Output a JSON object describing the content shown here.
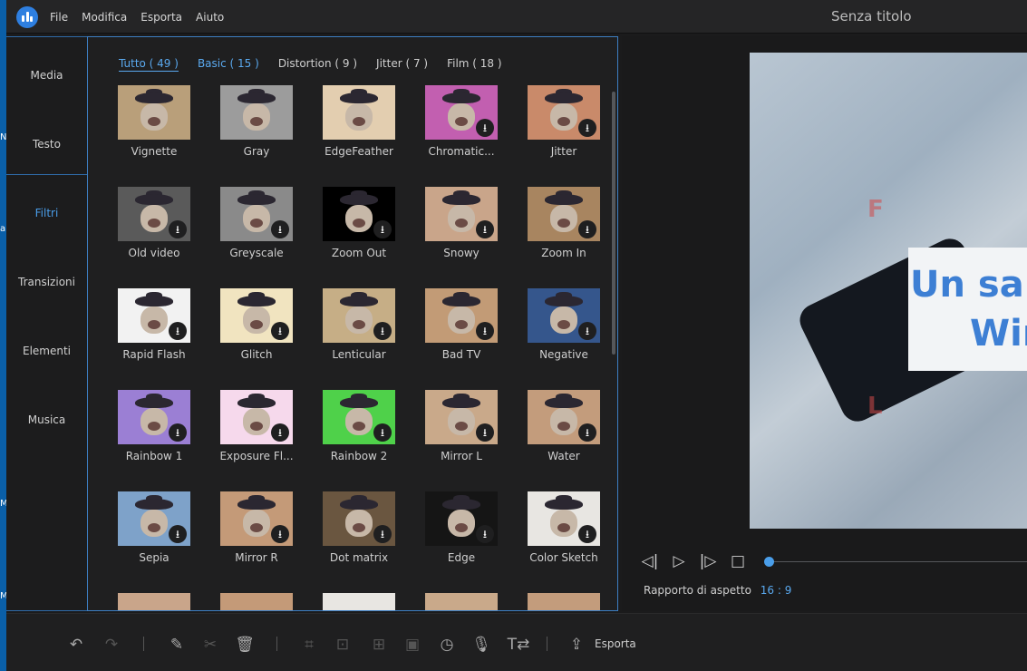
{
  "menu": {
    "file": "File",
    "edit": "Modifica",
    "export": "Esporta",
    "help": "Aiuto"
  },
  "window_title": "Senza titolo",
  "desktop_strip_labels": [
    "N",
    "a",
    "M",
    "M"
  ],
  "sidebar": {
    "items": [
      {
        "label": "Media",
        "active": false
      },
      {
        "label": "Testo",
        "active": false
      },
      {
        "label": "Filtri",
        "active": true
      },
      {
        "label": "Transizioni",
        "active": false
      },
      {
        "label": "Elementi",
        "active": false
      },
      {
        "label": "Musica",
        "active": false
      }
    ]
  },
  "filter_tabs": [
    {
      "label": "Tutto ( 49 )",
      "active": true
    },
    {
      "label": "Basic ( 15 )",
      "active": false
    },
    {
      "label": "Distortion ( 9 )",
      "active": false
    },
    {
      "label": "Jitter ( 7 )",
      "active": false
    },
    {
      "label": "Film ( 18 )",
      "active": false
    }
  ],
  "filters": [
    {
      "label": "Vignette",
      "downloadable": false,
      "bg": "#b99f7a"
    },
    {
      "label": "Gray",
      "downloadable": false,
      "bg": "#9c9c9c"
    },
    {
      "label": "EdgeFeather",
      "downloadable": false,
      "bg": "#e3ceb0"
    },
    {
      "label": "Chromatic...",
      "downloadable": true,
      "bg": "#c25fb0"
    },
    {
      "label": "Jitter",
      "downloadable": true,
      "bg": "#c98a6a"
    },
    {
      "label": "Old video",
      "downloadable": true,
      "bg": "#5a5a5a"
    },
    {
      "label": "Greyscale",
      "downloadable": true,
      "bg": "#8a8a8a"
    },
    {
      "label": "Zoom Out",
      "downloadable": true,
      "bg": "#000000"
    },
    {
      "label": "Snowy",
      "downloadable": true,
      "bg": "#c9a58a"
    },
    {
      "label": "Zoom In",
      "downloadable": true,
      "bg": "#a88560"
    },
    {
      "label": "Rapid Flash",
      "downloadable": true,
      "bg": "#f2f2f2"
    },
    {
      "label": "Glitch",
      "downloadable": true,
      "bg": "#f1e4c0"
    },
    {
      "label": "Lenticular",
      "downloadable": true,
      "bg": "#c6ae86"
    },
    {
      "label": "Bad TV",
      "downloadable": true,
      "bg": "#c29b76"
    },
    {
      "label": "Negative",
      "downloadable": true,
      "bg": "#35568c"
    },
    {
      "label": "Rainbow 1",
      "downloadable": true,
      "bg": "#9b7fd4"
    },
    {
      "label": "Exposure Fl...",
      "downloadable": true,
      "bg": "#f6d9ec"
    },
    {
      "label": "Rainbow 2",
      "downloadable": true,
      "bg": "#4fd14a"
    },
    {
      "label": "Mirror L",
      "downloadable": true,
      "bg": "#c9a98a"
    },
    {
      "label": "Water",
      "downloadable": true,
      "bg": "#c39c7c"
    },
    {
      "label": "Sepia",
      "downloadable": true,
      "bg": "#7ea2c9"
    },
    {
      "label": "Mirror R",
      "downloadable": true,
      "bg": "#c49a78"
    },
    {
      "label": "Dot matrix",
      "downloadable": true,
      "bg": "#6a5640"
    },
    {
      "label": "Edge",
      "downloadable": true,
      "bg": "#151515"
    },
    {
      "label": "Color Sketch",
      "downloadable": true,
      "bg": "#e8e6e2"
    }
  ],
  "partial_row_bgs": [
    "#c9a58a",
    "#c49a78",
    "#e8e6e2",
    "#c9a98a",
    "#c39c7c"
  ],
  "preview": {
    "overlay_line1": "Un sal",
    "overlay_line2": "Wir",
    "mark_top": "F",
    "mark_bottom": "L"
  },
  "aspect": {
    "label": "Rapporto di aspetto",
    "value": "16 : 9"
  },
  "playback_position": 0.0,
  "toolbar": {
    "export_label": "Esporta"
  },
  "colors": {
    "accent": "#4a9eea",
    "panel_border": "#3d7ec2"
  }
}
